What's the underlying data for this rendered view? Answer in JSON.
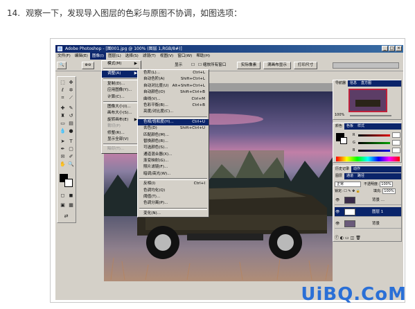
{
  "step": {
    "number": "14.",
    "text": "观察一下，发现导入图层的色彩与原图不协调，如图选项："
  },
  "window": {
    "title": "Adobe Photoshop - [图001.jpg @ 100% (图层 1,RGB/8#)]"
  },
  "menubar": [
    "文件(F)",
    "编辑(E)",
    "图像(I)",
    "图层(L)",
    "选择(S)",
    "滤镜(T)",
    "视图(V)",
    "窗口(W)",
    "帮助(H)"
  ],
  "optionsbar": {
    "show_label": "显示",
    "checkbox_label": "缩放所有窗口",
    "btn_actual": "实际像素",
    "btn_fit": "满画布显示",
    "btn_print": "打印尺寸"
  },
  "image_menu": [
    {
      "label": "模式(M)",
      "arrow": true
    },
    {
      "sep": true
    },
    {
      "label": "调整(A)",
      "arrow": true,
      "hi": true
    },
    {
      "sep": true
    },
    {
      "label": "复制(D)..."
    },
    {
      "label": "应用图像(Y)..."
    },
    {
      "label": "计算(C)..."
    },
    {
      "sep": true
    },
    {
      "label": "图像大小(I)..."
    },
    {
      "label": "画布大小(S)..."
    },
    {
      "label": "旋转画布(E)",
      "arrow": true
    },
    {
      "label": "裁切(P)",
      "dis": true
    },
    {
      "label": "修整(R)..."
    },
    {
      "label": "显示全部(V)"
    },
    {
      "sep": true
    },
    {
      "label": "陷印(T)...",
      "dis": true
    }
  ],
  "adjust_menu": [
    {
      "label": "色阶(L)...",
      "shortcut": "Ctrl+L"
    },
    {
      "label": "自动色阶(A)",
      "shortcut": "Shift+Ctrl+L"
    },
    {
      "label": "自动对比度(U)",
      "shortcut": "Alt+Shift+Ctrl+L"
    },
    {
      "label": "自动颜色(O)",
      "shortcut": "Shift+Ctrl+B"
    },
    {
      "label": "曲线(V)...",
      "shortcut": "Ctrl+M"
    },
    {
      "label": "色彩平衡(B)...",
      "shortcut": "Ctrl+B"
    },
    {
      "label": "亮度/对比度(C)..."
    },
    {
      "sep": true
    },
    {
      "label": "色相/饱和度(H)...",
      "shortcut": "Ctrl+U",
      "hi": true
    },
    {
      "label": "去色(D)",
      "shortcut": "Shift+Ctrl+U"
    },
    {
      "label": "匹配颜色(M)..."
    },
    {
      "label": "替换颜色(R)..."
    },
    {
      "label": "可选颜色(S)..."
    },
    {
      "label": "通道混合器(X)..."
    },
    {
      "label": "渐变映射(G)..."
    },
    {
      "label": "照片滤镜(F)..."
    },
    {
      "label": "暗调/高光(W)..."
    },
    {
      "sep": true
    },
    {
      "label": "反相(I)",
      "shortcut": "Ctrl+I"
    },
    {
      "label": "色调均化(Q)"
    },
    {
      "label": "阈值(T)..."
    },
    {
      "label": "色调分离(P)..."
    },
    {
      "sep": true
    },
    {
      "label": "变化(N)..."
    }
  ],
  "navigator_tabs": [
    "导航器",
    "信息",
    "直方图"
  ],
  "navigator_zoom": "100%",
  "color_tabs": [
    "颜色",
    "色板",
    "样式"
  ],
  "color_channels": [
    "R",
    "G",
    "B"
  ],
  "layers_tabs_top": [
    "历史记录",
    "动作"
  ],
  "layers_tabs": [
    "图层",
    "通道",
    "路径"
  ],
  "layers": {
    "blend_mode": "正常",
    "opacity_label": "不透明度:",
    "opacity": "100%",
    "lock_label": "锁定:",
    "fill_label": "填充:",
    "fill": "100%",
    "items": [
      {
        "name": "背景 ...",
        "selected": false
      },
      {
        "name": "图层 1",
        "selected": true
      },
      {
        "name": "背景",
        "selected": false
      }
    ]
  },
  "watermark": "UiBQ.CoM",
  "colors": {
    "titlebar": "#0a246a",
    "highlight": "#0a246a",
    "accent": "#2a6fd6"
  }
}
